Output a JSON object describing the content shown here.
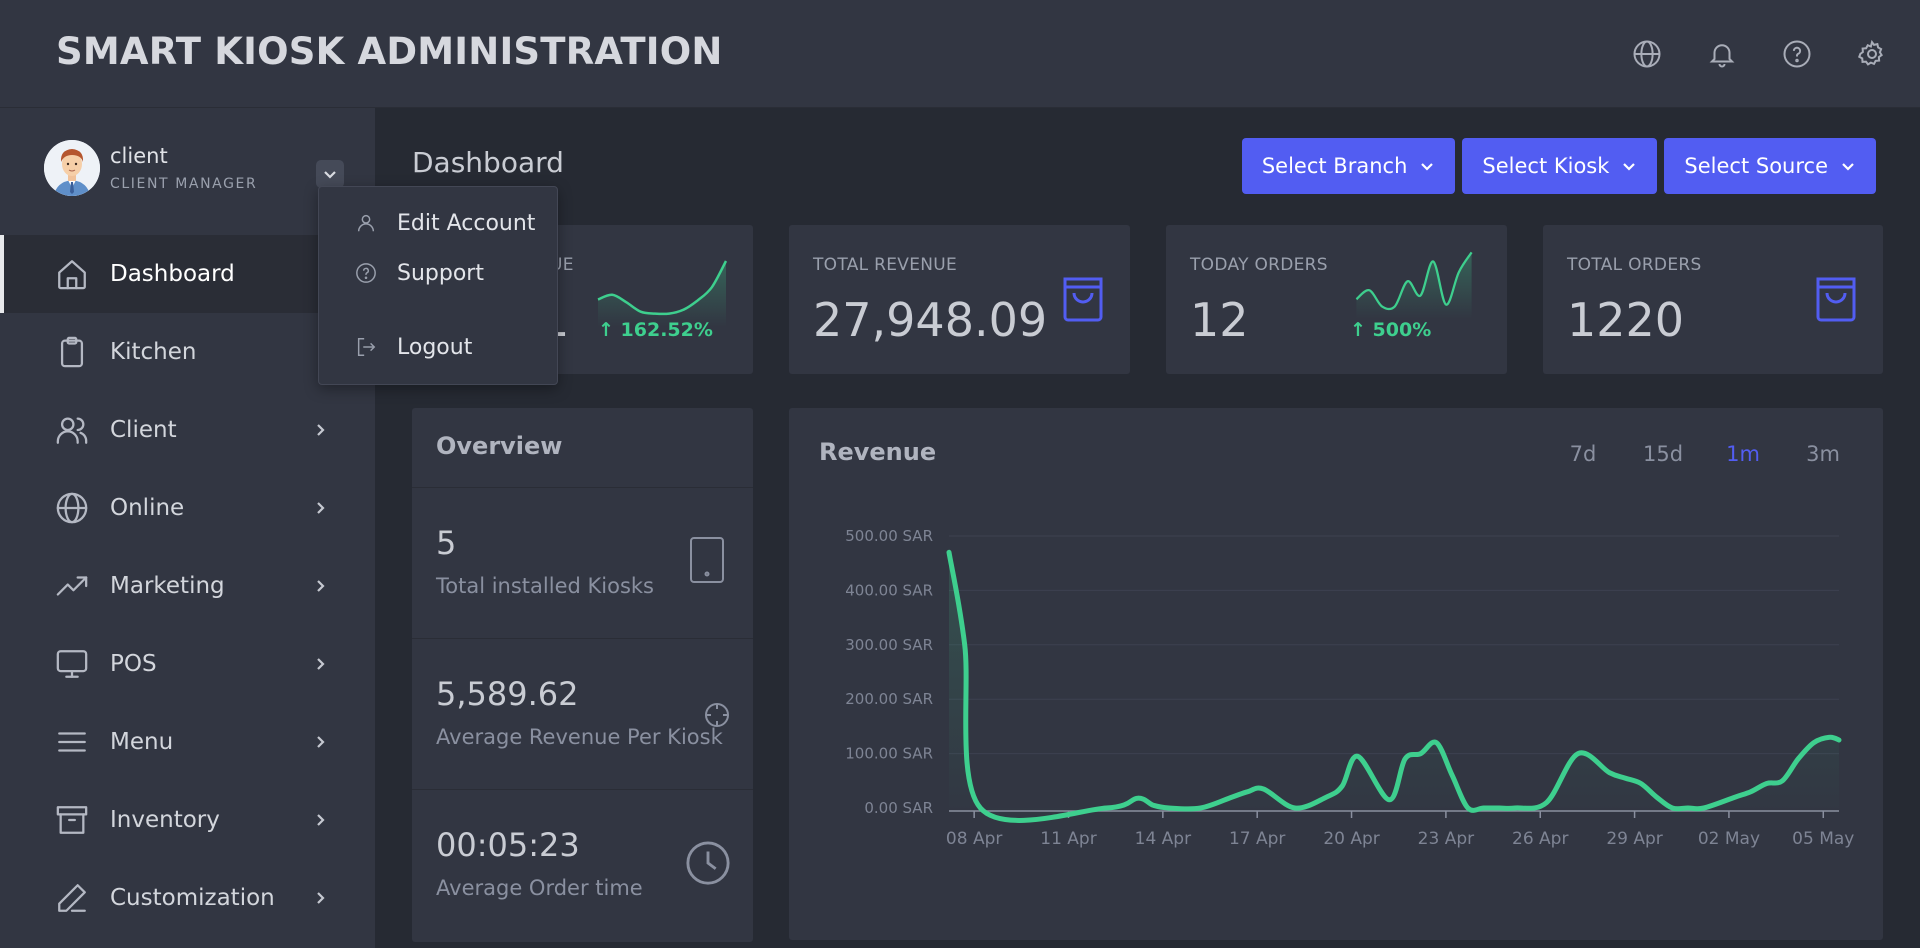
{
  "app": {
    "title": "SMART KIOSK ADMINISTRATION"
  },
  "topbar": {
    "icons": [
      "globe-icon",
      "bell-icon",
      "help-icon",
      "gear-icon"
    ]
  },
  "user": {
    "name": "client",
    "role": "CLIENT MANAGER"
  },
  "user_menu": {
    "items": [
      {
        "label": "Edit Account",
        "icon": "user-icon"
      },
      {
        "label": "Support",
        "icon": "help-circle-icon"
      },
      {
        "label": "Logout",
        "icon": "logout-icon"
      }
    ]
  },
  "sidebar": {
    "items": [
      {
        "label": "Dashboard",
        "icon": "home-icon",
        "active": true,
        "has_children": false
      },
      {
        "label": "Kitchen",
        "icon": "clipboard-icon",
        "active": false,
        "has_children": false
      },
      {
        "label": "Client",
        "icon": "users-icon",
        "active": false,
        "has_children": true
      },
      {
        "label": "Online",
        "icon": "globe-icon",
        "active": false,
        "has_children": true
      },
      {
        "label": "Marketing",
        "icon": "trending-up-icon",
        "active": false,
        "has_children": true
      },
      {
        "label": "POS",
        "icon": "monitor-icon",
        "active": false,
        "has_children": true
      },
      {
        "label": "Menu",
        "icon": "menu-lines-icon",
        "active": false,
        "has_children": true
      },
      {
        "label": "Inventory",
        "icon": "archive-icon",
        "active": false,
        "has_children": true
      },
      {
        "label": "Customization",
        "icon": "pen-icon",
        "active": false,
        "has_children": true
      }
    ]
  },
  "page": {
    "title": "Dashboard"
  },
  "filters": {
    "branch": "Select Branch",
    "kiosk": "Select Kiosk",
    "source": "Select Source"
  },
  "stats": {
    "today_revenue": {
      "label": "UE",
      "value": "1",
      "trend": "162.52%"
    },
    "total_revenue": {
      "label": "TOTAL REVENUE",
      "value": "27,948.09"
    },
    "today_orders": {
      "label": "TODAY ORDERS",
      "value": "12",
      "trend": "500%"
    },
    "total_orders": {
      "label": "TOTAL ORDERS",
      "value": "1220"
    }
  },
  "overview": {
    "title": "Overview",
    "rows": [
      {
        "value": "5",
        "caption": "Total installed Kiosks",
        "icon": "tablet-icon"
      },
      {
        "value": "5,589.62",
        "caption": "Average Revenue Per Kiosk",
        "icon": "crosshair-icon"
      },
      {
        "value": "00:05:23",
        "caption": "Average Order time",
        "icon": "clock-icon"
      }
    ]
  },
  "revenue": {
    "title": "Revenue",
    "ranges": [
      {
        "label": "7d",
        "active": false
      },
      {
        "label": "15d",
        "active": false
      },
      {
        "label": "1m",
        "active": true
      },
      {
        "label": "3m",
        "active": false
      }
    ]
  },
  "colors": {
    "accent": "#525df2",
    "positive": "#3ecf8e",
    "panel": "#323642",
    "background": "#262a33"
  },
  "chart_data": {
    "type": "area",
    "title": "Revenue",
    "x_tick_labels": [
      "08 Apr",
      "11 Apr",
      "14 Apr",
      "17 Apr",
      "20 Apr",
      "23 Apr",
      "26 Apr",
      "29 Apr",
      "02 May",
      "05 May"
    ],
    "y_tick_labels": [
      "0.00 SAR",
      "100.00 SAR",
      "200.00 SAR",
      "300.00 SAR",
      "400.00 SAR",
      "500.00 SAR"
    ],
    "ylim": [
      0,
      500
    ],
    "grid": true,
    "series": [
      {
        "x": [
          0,
          0.5,
          1,
          5,
          6,
          6.5,
          7,
          8,
          9,
          9.5,
          10,
          11,
          12,
          12.5,
          13,
          14,
          14.5,
          15,
          15.5,
          16,
          16.5,
          17,
          17.5,
          18,
          19,
          20,
          21,
          21.5,
          22,
          22.5,
          23,
          23.5,
          24,
          25,
          25.5,
          26,
          26.5,
          27,
          27.5,
          28,
          28.3
        ],
        "values": [
          470,
          300,
          0,
          0,
          18,
          5,
          0,
          0,
          20,
          30,
          35,
          0,
          20,
          40,
          95,
          15,
          90,
          100,
          120,
          60,
          0,
          0,
          0,
          0,
          10,
          100,
          65,
          55,
          45,
          20,
          0,
          0,
          0,
          20,
          30,
          45,
          50,
          90,
          120,
          130,
          125
        ]
      }
    ]
  },
  "sparklines": {
    "today_revenue": [
      25,
      30,
      22,
      12,
      10,
      10,
      14,
      24,
      38,
      66
    ],
    "today_orders": [
      18,
      28,
      10,
      10,
      38,
      22,
      60,
      12,
      48,
      70
    ]
  }
}
